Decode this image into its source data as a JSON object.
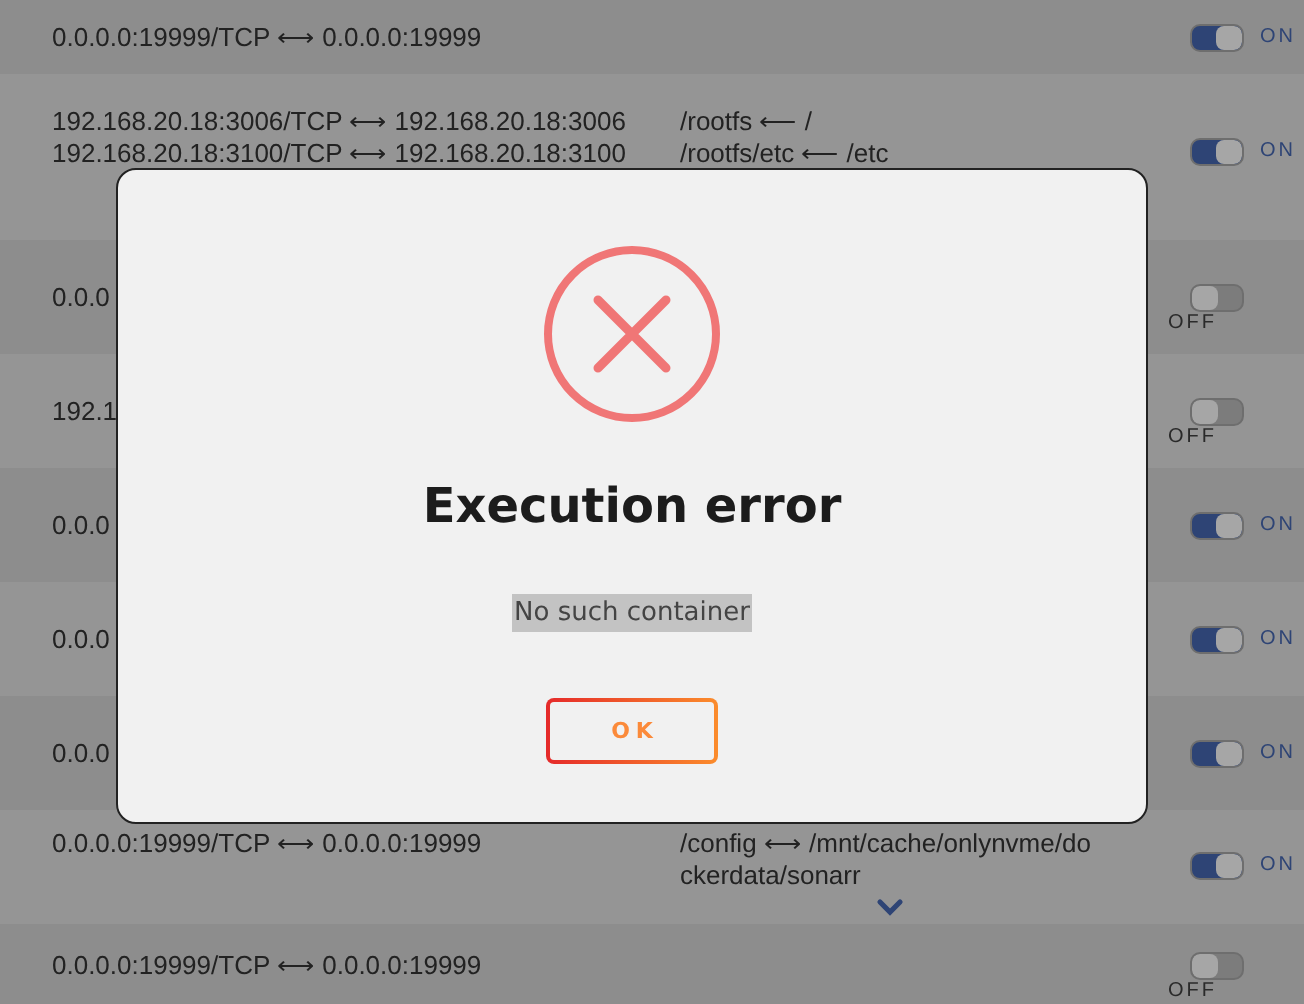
{
  "rows": [
    {
      "ports": [
        "0.0.0.0:19999/TCP ⟷ 0.0.0.0:19999"
      ],
      "on": true,
      "state_label": "ON"
    },
    {
      "ports": [
        "192.168.20.18:3006/TCP ⟷ 192.168.20.18:3006",
        "192.168.20.18:3100/TCP ⟷ 192.168.20.18:3100"
      ],
      "volumes": [
        "/rootfs ⟵ /",
        "/rootfs/etc ⟵ /etc"
      ],
      "on": true,
      "state_label": "ON"
    },
    {
      "ports": [
        "0.0.0"
      ],
      "on": false,
      "state_label": "OFF"
    },
    {
      "ports": [
        "192.1"
      ],
      "on": false,
      "state_label": "OFF"
    },
    {
      "ports": [
        "0.0.0"
      ],
      "on": true,
      "state_label": "ON"
    },
    {
      "ports": [
        "0.0.0"
      ],
      "on": true,
      "state_label": "ON"
    },
    {
      "ports": [
        "0.0.0"
      ],
      "on": true,
      "state_label": "ON"
    },
    {
      "ports": [
        "0.0.0.0:19999/TCP ⟷ 0.0.0.0:19999"
      ],
      "volumes": [
        "/config ⟷ /mnt/cache/onlynvme/dockerdata/sonarr"
      ],
      "expandable": true,
      "on": true,
      "state_label": "ON"
    },
    {
      "ports": [
        "0.0.0.0:19999/TCP ⟷ 0.0.0.0:19999"
      ],
      "on": false,
      "state_label": "OFF"
    }
  ],
  "dialog": {
    "title": "Execution error",
    "message": "No such container",
    "button": "OK"
  }
}
